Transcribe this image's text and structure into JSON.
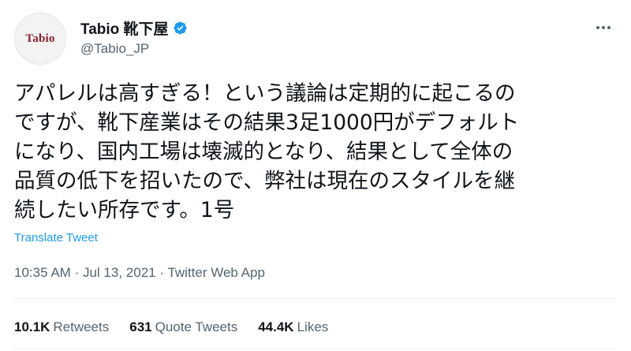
{
  "account": {
    "display_name": "Tabio 靴下屋",
    "handle": "@Tabio_JP",
    "avatar_text": "Tabio",
    "verified": true
  },
  "tweet": {
    "text": "アパレルは高すぎる！という議論は定期的に起こるの\nですが、靴下産業はその結果3足1000円がデフォルト\nになり、国内工場は壊滅的となり、結果として全体の\n品質の低下を招いたので、弊社は現在のスタイルを継\n続したい所存です。1号",
    "translate_label": "Translate Tweet",
    "time": "10:35 AM",
    "separator": "·",
    "date": "Jul 13, 2021",
    "source": "Twitter Web App"
  },
  "stats": {
    "retweets_count": "10.1K",
    "retweets_label": "Retweets",
    "quote_tweets_count": "631",
    "quote_tweets_label": "Quote Tweets",
    "likes_count": "44.4K",
    "likes_label": "Likes"
  },
  "icons": {
    "verified": "verified-badge-icon",
    "more": "more-horizontal-icon"
  },
  "colors": {
    "accent": "#1d9bf0",
    "text": "#0f1419",
    "secondary": "#536471",
    "avatar_brand": "#8b1d2c"
  }
}
